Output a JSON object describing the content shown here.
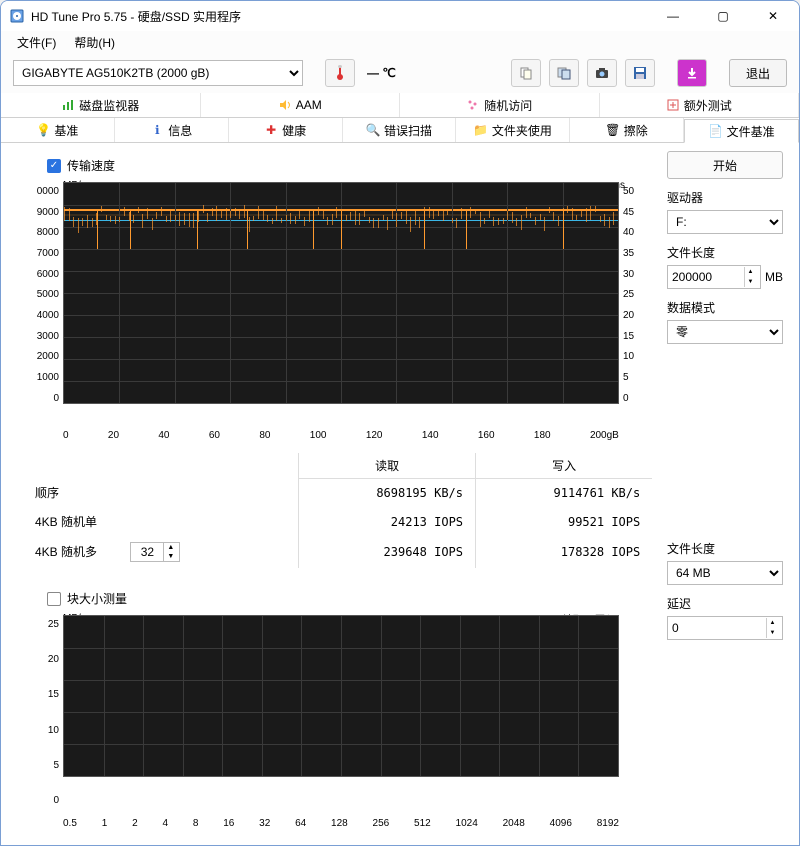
{
  "titlebar": {
    "title": "HD Tune Pro 5.75 - 硬盘/SSD 实用程序"
  },
  "menubar": {
    "file": "文件(F)",
    "help": "帮助(H)"
  },
  "toolbar": {
    "drive": "GIGABYTE AG510K2TB (2000 gB)",
    "exit": "退出"
  },
  "tabs_row1": [
    {
      "icon": "chart-bar",
      "label": "磁盘监视器"
    },
    {
      "icon": "speaker",
      "label": "AAM"
    },
    {
      "icon": "dots",
      "label": "随机访问"
    },
    {
      "icon": "plus-sq",
      "label": "额外测试"
    }
  ],
  "tabs_row2": [
    {
      "icon": "bulb",
      "label": "基准"
    },
    {
      "icon": "info",
      "label": "信息"
    },
    {
      "icon": "health",
      "label": "健康"
    },
    {
      "icon": "search",
      "label": "错误扫描"
    },
    {
      "icon": "folder",
      "label": "文件夹使用"
    },
    {
      "icon": "trash",
      "label": "擦除"
    },
    {
      "icon": "file",
      "label": "文件基准",
      "active": true
    }
  ],
  "panel": {
    "transfer_cb": "传输速度",
    "block_cb": "块大小测量",
    "legend_read": "读取",
    "legend_write": "写入"
  },
  "results": {
    "col_read": "读取",
    "col_write": "写入",
    "row_seq": "顺序",
    "row_4k_single": "4KB 随机单",
    "row_4k_multi": "4KB 随机多",
    "multi_depth": "32",
    "seq_read": "8698195 KB/s",
    "seq_write": "9114761 KB/s",
    "rnd_single_read": "24213 IOPS",
    "rnd_single_write": "99521 IOPS",
    "rnd_multi_read": "239648 IOPS",
    "rnd_multi_write": "178328 IOPS"
  },
  "side": {
    "start": "开始",
    "drive_label": "驱动器",
    "drive_value": "F:",
    "filelen_label": "文件长度",
    "filelen_value": "200000",
    "filelen_unit": "MB",
    "pattern_label": "数据模式",
    "pattern_value": "零",
    "filelen2_label": "文件长度",
    "filelen2_value": "64 MB",
    "delay_label": "延迟",
    "delay_value": "0"
  },
  "chart_data": [
    {
      "type": "line",
      "title": "传输速度",
      "xlabel": "gB",
      "ylabel_left": "MB/s",
      "ylabel_right": "ms",
      "x_ticks": [
        0,
        20,
        40,
        60,
        80,
        100,
        120,
        140,
        160,
        180,
        "200gB"
      ],
      "y_ticks_left": [
        0,
        1000,
        2000,
        3000,
        4000,
        5000,
        6000,
        7000,
        8000,
        9000,
        "0000"
      ],
      "y_ticks_right": [
        0,
        5,
        10,
        15,
        20,
        25,
        30,
        35,
        40,
        45,
        50
      ],
      "xlim": [
        0,
        200
      ],
      "ylim_left": [
        0,
        10000
      ],
      "ylim_right": [
        0,
        50
      ],
      "series": [
        {
          "name": "写入",
          "color": "#ff9a2e",
          "approx_value": 9100,
          "spikes_down_x": [
            12,
            24,
            48,
            66,
            90,
            100,
            130,
            145,
            180
          ],
          "spike_low": 7200
        },
        {
          "name": "读取",
          "color": "#3ab6e6",
          "approx_value": 8500
        }
      ]
    },
    {
      "type": "line",
      "title": "块大小测量",
      "xlabel": "KB",
      "ylabel": "MB/s",
      "x_ticks": [
        0.5,
        1,
        2,
        4,
        8,
        16,
        32,
        64,
        128,
        256,
        512,
        1024,
        2048,
        4096,
        8192
      ],
      "y_ticks": [
        0,
        5,
        10,
        15,
        20,
        25
      ],
      "series": [
        {
          "name": "读取",
          "color": "#3ab6e6",
          "values": []
        },
        {
          "name": "写入",
          "color": "#ff9a2e",
          "values": []
        }
      ]
    }
  ]
}
